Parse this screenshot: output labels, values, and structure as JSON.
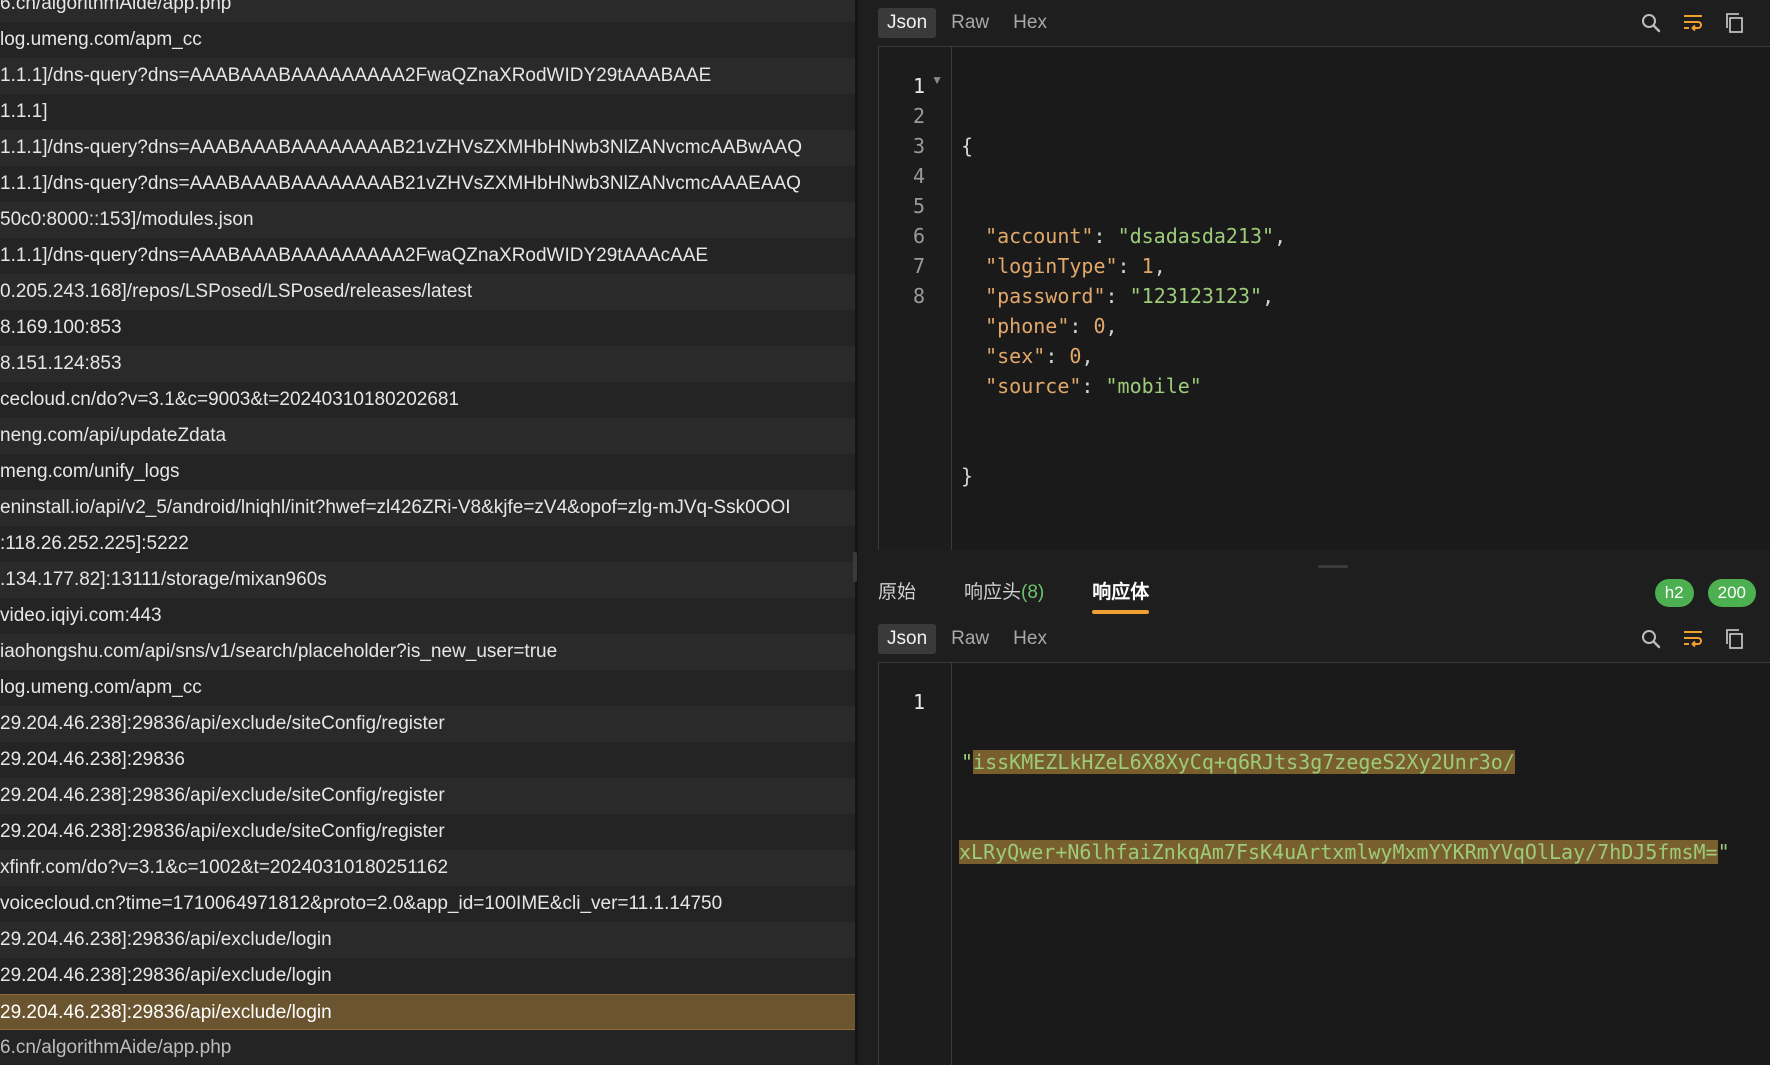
{
  "request_list": [
    "6.cn/algorithmAide/app.php",
    "log.umeng.com/apm_cc",
    "1.1.1]/dns-query?dns=AAABAAABAAAAAAAAA2FwaQZnaXRodWIDY29tAAABAAE",
    "1.1.1]",
    "1.1.1]/dns-query?dns=AAABAAABAAAAAAAAB21vZHVsZXMHbHNwb3NlZANvcmcAABwAAQ",
    "1.1.1]/dns-query?dns=AAABAAABAAAAAAAAB21vZHVsZXMHbHNwb3NlZANvcmcAAAEAAQ",
    "50c0:8000::153]/modules.json",
    "1.1.1]/dns-query?dns=AAABAAABAAAAAAAAA2FwaQZnaXRodWIDY29tAAAcAAE",
    "0.205.243.168]/repos/LSPosed/LSPosed/releases/latest",
    "8.169.100:853",
    "8.151.124:853",
    "cecloud.cn/do?v=3.1&c=9003&t=20240310180202681",
    "neng.com/api/updateZdata",
    "meng.com/unify_logs",
    "eninstall.io/api/v2_5/android/lniqhl/init?hwef=zl426ZRi-V8&kjfe=zV4&opof=zlg-mJVq-Ssk0OOI",
    ":118.26.252.225]:5222",
    ".134.177.82]:13111/storage/mixan960s",
    "video.iqiyi.com:443",
    "iaohongshu.com/api/sns/v1/search/placeholder?is_new_user=true",
    "log.umeng.com/apm_cc",
    "29.204.46.238]:29836/api/exclude/siteConfig/register",
    "29.204.46.238]:29836",
    "29.204.46.238]:29836/api/exclude/siteConfig/register",
    "29.204.46.238]:29836/api/exclude/siteConfig/register",
    "xfinfr.com/do?v=3.1&c=1002&t=20240310180251162",
    "voicecloud.cn?time=1710064971812&proto=2.0&app_id=100IME&cli_ver=11.1.14750",
    "29.204.46.238]:29836/api/exclude/login",
    "29.204.46.238]:29836/api/exclude/login",
    "29.204.46.238]:29836/api/exclude/login",
    "6.cn/algorithmAide/app.php"
  ],
  "selected_index": 28,
  "request_panel": {
    "format_tabs": [
      "Json",
      "Raw",
      "Hex"
    ],
    "active_format": "Json",
    "line_numbers": [
      "1",
      "2",
      "3",
      "4",
      "5",
      "6",
      "7",
      "8"
    ],
    "body": {
      "open": "{",
      "close": "}",
      "fields": [
        {
          "key": "\"account\"",
          "value": "\"dsadasda213\"",
          "type": "string",
          "comma": ","
        },
        {
          "key": "\"loginType\"",
          "value": "1",
          "type": "number",
          "comma": ","
        },
        {
          "key": "\"password\"",
          "value": "\"123123123\"",
          "type": "string",
          "comma": ","
        },
        {
          "key": "\"phone\"",
          "value": "0",
          "type": "number",
          "comma": ","
        },
        {
          "key": "\"sex\"",
          "value": "0",
          "type": "number",
          "comma": ","
        },
        {
          "key": "\"source\"",
          "value": "\"mobile\"",
          "type": "string",
          "comma": ""
        }
      ]
    }
  },
  "response_tabs": {
    "raw": "原始",
    "headers": "响应头",
    "headers_count": "(8)",
    "body": "响应体",
    "active": "响应体"
  },
  "badges": {
    "protocol": "h2",
    "status": "200"
  },
  "response_panel": {
    "format_tabs": [
      "Json",
      "Raw",
      "Hex"
    ],
    "active_format": "Json",
    "line_number": "1",
    "quote": "\"",
    "value_line1": "issKMEZLkHZeL6X8XyCq+q6RJts3g7zegeS2Xy2Unr3o/",
    "value_line2": "xLRyQwer+N6lhfaiZnkqAm7FsK4uArtxmlwyMxmYYKRmYVqOlLay/7hDJ5fmsM="
  },
  "icons": [
    "search-icon",
    "wrap-icon",
    "copy-icon"
  ],
  "colors": {
    "accent": "#f0a030",
    "selected_row": "#6b5530",
    "string": "#9ccc7a",
    "key": "#e2a86a",
    "badge": "#4caf50"
  }
}
